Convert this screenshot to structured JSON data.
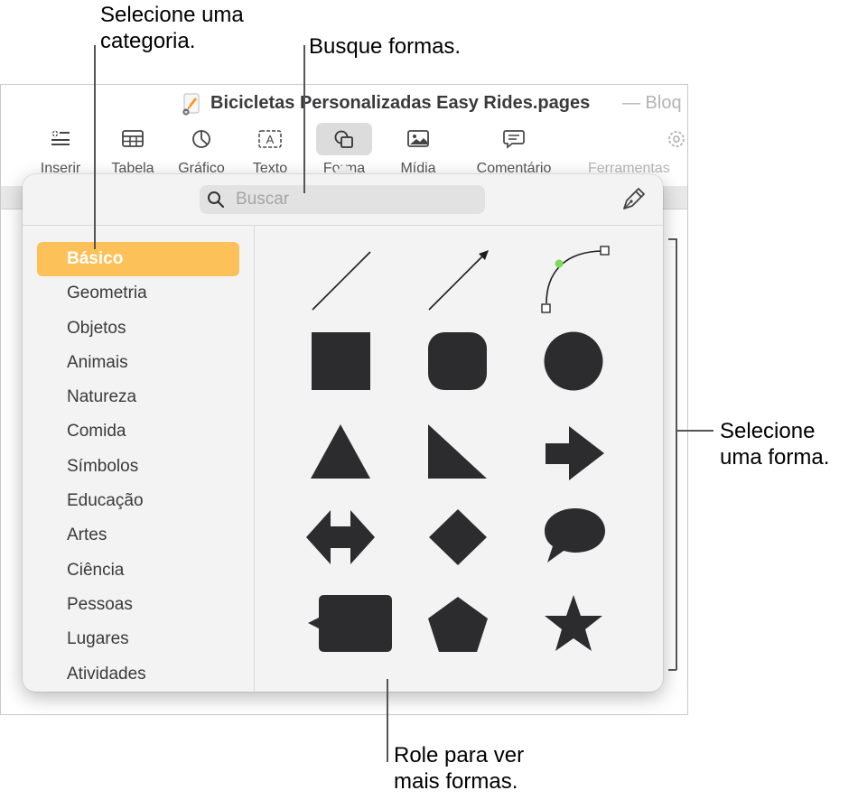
{
  "callouts": {
    "category_line1": "Selecione uma",
    "category_line2": "categoria.",
    "search_label": "Busque formas.",
    "shape_line1": "Selecione",
    "shape_line2": "uma forma.",
    "scroll_line1": "Role para ver",
    "scroll_line2": "mais formas."
  },
  "window": {
    "title": "Bicicletas Personalizadas Easy Rides.pages",
    "title_suffix": "— Bloq"
  },
  "toolbar": {
    "insert": "Inserir",
    "table": "Tabela",
    "chart": "Gráfico",
    "text": "Texto",
    "shape": "Forma",
    "media": "Mídia",
    "comment": "Comentário",
    "tools": "Ferramentas"
  },
  "popover": {
    "search_placeholder": "Buscar",
    "categories": [
      "Básico",
      "Geometria",
      "Objetos",
      "Animais",
      "Natureza",
      "Comida",
      "Símbolos",
      "Educação",
      "Artes",
      "Ciência",
      "Pessoas",
      "Lugares",
      "Atividades"
    ],
    "selected_category": "Básico",
    "shapes": [
      "line",
      "arrow-line",
      "curve",
      "square",
      "rounded-square",
      "circle",
      "triangle",
      "right-triangle",
      "arrow",
      "double-arrow",
      "diamond",
      "speech-bubble",
      "callout-square",
      "pentagon",
      "star"
    ]
  },
  "colors": {
    "selected_category": "#fdc15a",
    "shape_fill": "#2c2c2e",
    "curve_handle": "#7ed957"
  }
}
